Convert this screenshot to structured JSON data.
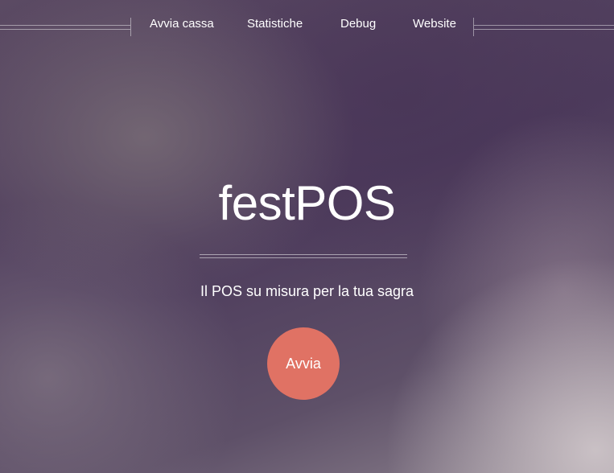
{
  "nav": {
    "items": [
      {
        "label": "Avvia cassa"
      },
      {
        "label": "Statistiche"
      },
      {
        "label": "Debug"
      },
      {
        "label": "Website"
      }
    ]
  },
  "hero": {
    "title": "festPOS",
    "subtitle": "Il POS su misura per la tua sagra",
    "start_label": "Avvia",
    "start_color": "#e07264"
  }
}
